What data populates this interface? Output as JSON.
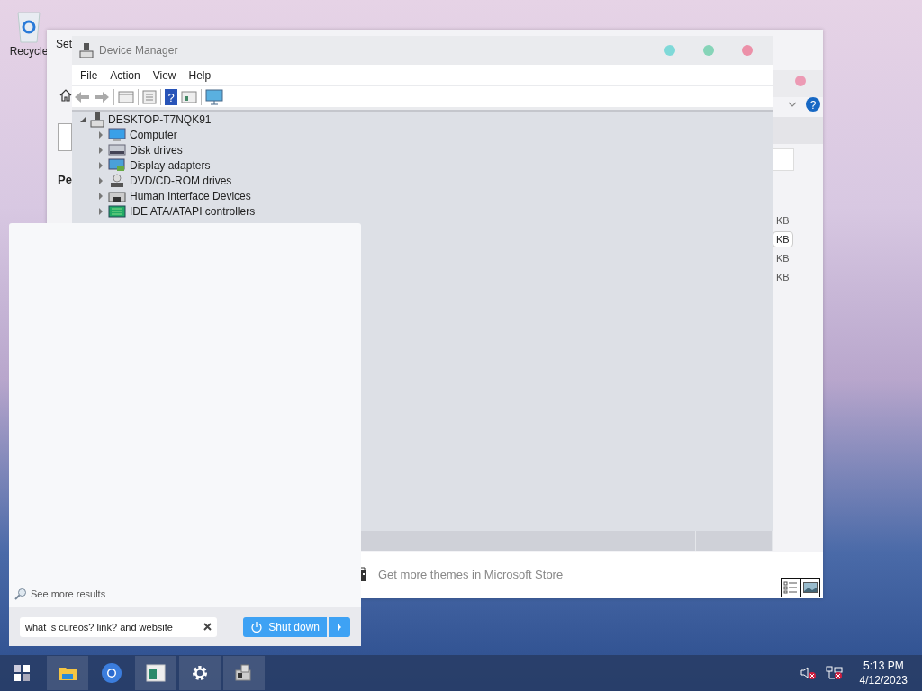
{
  "desktop": {
    "icons": [
      {
        "label": "Recycle"
      }
    ]
  },
  "settings_window": {
    "title": "Set",
    "heading": "Pe",
    "help_icon": "?",
    "size_labels": [
      {
        "text": "KB",
        "selected": false
      },
      {
        "text": "KB",
        "selected": true
      },
      {
        "text": "KB",
        "selected": false
      },
      {
        "text": "KB",
        "selected": false
      }
    ],
    "store_link": "Get more themes in Microsoft Store",
    "view_buttons": [
      {
        "kind": "list",
        "selected": true
      },
      {
        "kind": "preview",
        "selected": true
      }
    ]
  },
  "device_manager": {
    "title": "Device Manager",
    "menu": [
      "File",
      "Action",
      "View",
      "Help"
    ],
    "help_icon": "?",
    "tree": {
      "label": "DESKTOP-T7NQK91",
      "expanded": true,
      "children": [
        {
          "label": "Computer",
          "kind": "computer",
          "expanded": false
        },
        {
          "label": "Disk drives",
          "kind": "disk",
          "expanded": false
        },
        {
          "label": "Display adapters",
          "kind": "display",
          "expanded": false
        },
        {
          "label": "DVD/CD-ROM drives",
          "kind": "dvd",
          "expanded": false
        },
        {
          "label": "Human Interface Devices",
          "kind": "hid",
          "expanded": false
        },
        {
          "label": "IDE ATA/ATAPI controllers",
          "kind": "ide",
          "expanded": false
        }
      ]
    }
  },
  "search_panel": {
    "see_more": "See more results",
    "query": "what is cureos? link? and website",
    "shutdown_button": "Shut down"
  },
  "taskbar": {
    "apps": [
      {
        "kind": "folder",
        "open": true
      },
      {
        "kind": "browser",
        "open": false
      },
      {
        "kind": "window",
        "open": true
      },
      {
        "kind": "settings",
        "open": true
      },
      {
        "kind": "device",
        "open": true
      }
    ],
    "clock": {
      "time": "5:13 PM",
      "date": "4/12/2023"
    }
  }
}
